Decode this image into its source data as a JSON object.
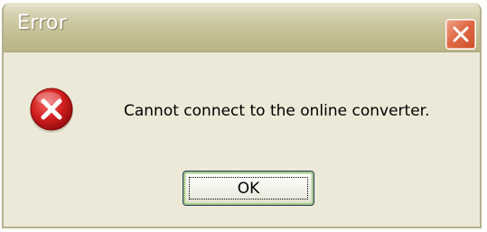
{
  "dialog": {
    "title": "Error",
    "message": "Cannot connect to the online converter.",
    "ok_label": "OK",
    "icons": {
      "close": "close-icon",
      "error": "error-icon"
    }
  },
  "colors": {
    "window_face": "#ece9d8",
    "titlebar": "#c0bb8e",
    "close_button": "#e06b46",
    "error_icon": "#d21e1e",
    "ok_focus_ring": "#a9c98a"
  }
}
